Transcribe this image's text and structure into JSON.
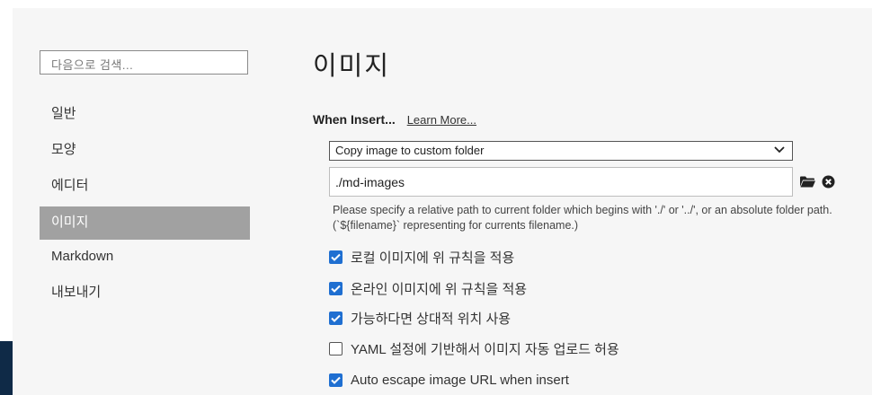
{
  "search": {
    "placeholder": "다음으로 검색..."
  },
  "sidebar": {
    "items": [
      {
        "label": "일반",
        "active": false
      },
      {
        "label": "모양",
        "active": false
      },
      {
        "label": "에디터",
        "active": false
      },
      {
        "label": "이미지",
        "active": true
      },
      {
        "label": "Markdown",
        "active": false
      },
      {
        "label": "내보내기",
        "active": false
      }
    ]
  },
  "page": {
    "title": "이미지"
  },
  "when_insert": {
    "label": "When Insert...",
    "learn_more": "Learn More...",
    "select_value": "Copy image to custom folder",
    "path_value": "./md-images",
    "hint": "Please specify a relative path to current folder which begins with './' or '../', or an absolute folder path. (`${filename}` representing for currents filename.)"
  },
  "checkboxes": [
    {
      "label": "로컬 이미지에 위 규칙을 적용",
      "checked": true
    },
    {
      "label": "온라인 이미지에 위 규칙을 적용",
      "checked": true
    },
    {
      "label": "가능하다면 상대적 위치 사용",
      "checked": true
    },
    {
      "label": "YAML 설정에 기반해서 이미지 자동 업로드 허용",
      "checked": false
    },
    {
      "label": "Auto escape image URL when insert",
      "checked": true
    }
  ],
  "colors": {
    "accent": "#1f6fd1",
    "sidebar_active": "#a1a1a1",
    "panel_bg": "#f6f6f6"
  },
  "icons": {
    "folder": "folder-icon",
    "clear": "clear-circle-icon",
    "dropdown": "chevron-down-icon"
  }
}
